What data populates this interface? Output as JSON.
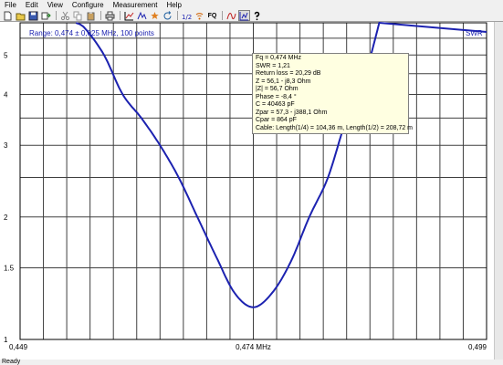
{
  "menu": [
    "File",
    "Edit",
    "View",
    "Configure",
    "Measurement",
    "Help"
  ],
  "toolbar": {
    "fq_label": "FQ",
    "icons": [
      "new-icon",
      "open-icon",
      "save-icon",
      "export-icon",
      "cut-icon",
      "copy-icon",
      "paste-icon",
      "print-icon",
      "chart-icon",
      "sweep-icon",
      "star-icon",
      "refresh-icon",
      "scale-icon",
      "signal-icon",
      "fq-icon",
      "graph-icon",
      "zoom-icon",
      "help-icon"
    ]
  },
  "plot": {
    "range_label": "Range: 0,474 ± 0,025 MHz, 100 points",
    "series_label": "SWR",
    "x_ticks": [
      "0,449",
      "0,474 MHz",
      "0,499"
    ],
    "y_ticks": [
      "5",
      "4",
      "3",
      "2",
      "1.5",
      "1"
    ],
    "line_color": "#1c22b0",
    "grid_color": "#404040"
  },
  "chart_data": {
    "type": "line",
    "series": [
      {
        "name": "SWR",
        "x": [
          0.455,
          0.456,
          0.458,
          0.46,
          0.462,
          0.464,
          0.466,
          0.468,
          0.47,
          0.472,
          0.474,
          0.476,
          0.478,
          0.48,
          0.482,
          0.484,
          0.486,
          0.4875
        ],
        "y": [
          6.0,
          5.8,
          5.0,
          4.0,
          3.5,
          3.0,
          2.5,
          2.0,
          1.6,
          1.3,
          1.2,
          1.3,
          1.55,
          2.0,
          2.5,
          3.5,
          4.5,
          6.0
        ]
      }
    ],
    "xlim": [
      0.449,
      0.499
    ],
    "ylim": [
      1,
      6
    ],
    "grid": true
  },
  "info": {
    "lines": [
      "Fq = 0,474 MHz",
      "SWR = 1,21",
      "Return loss = 20,29 dB",
      "Z = 56,1 - j8,3 Ohm",
      "|Z| = 56,7 Ohm",
      "Phase = -8,4 °",
      "C = 40463 pF",
      "Zpar = 57,3 - j388,1 Ohm",
      "Cpar = 864 pF",
      "Cable: Length(1/4) = 104,36 m, Length(1/2) = 208,72 m"
    ]
  },
  "status": "Ready"
}
